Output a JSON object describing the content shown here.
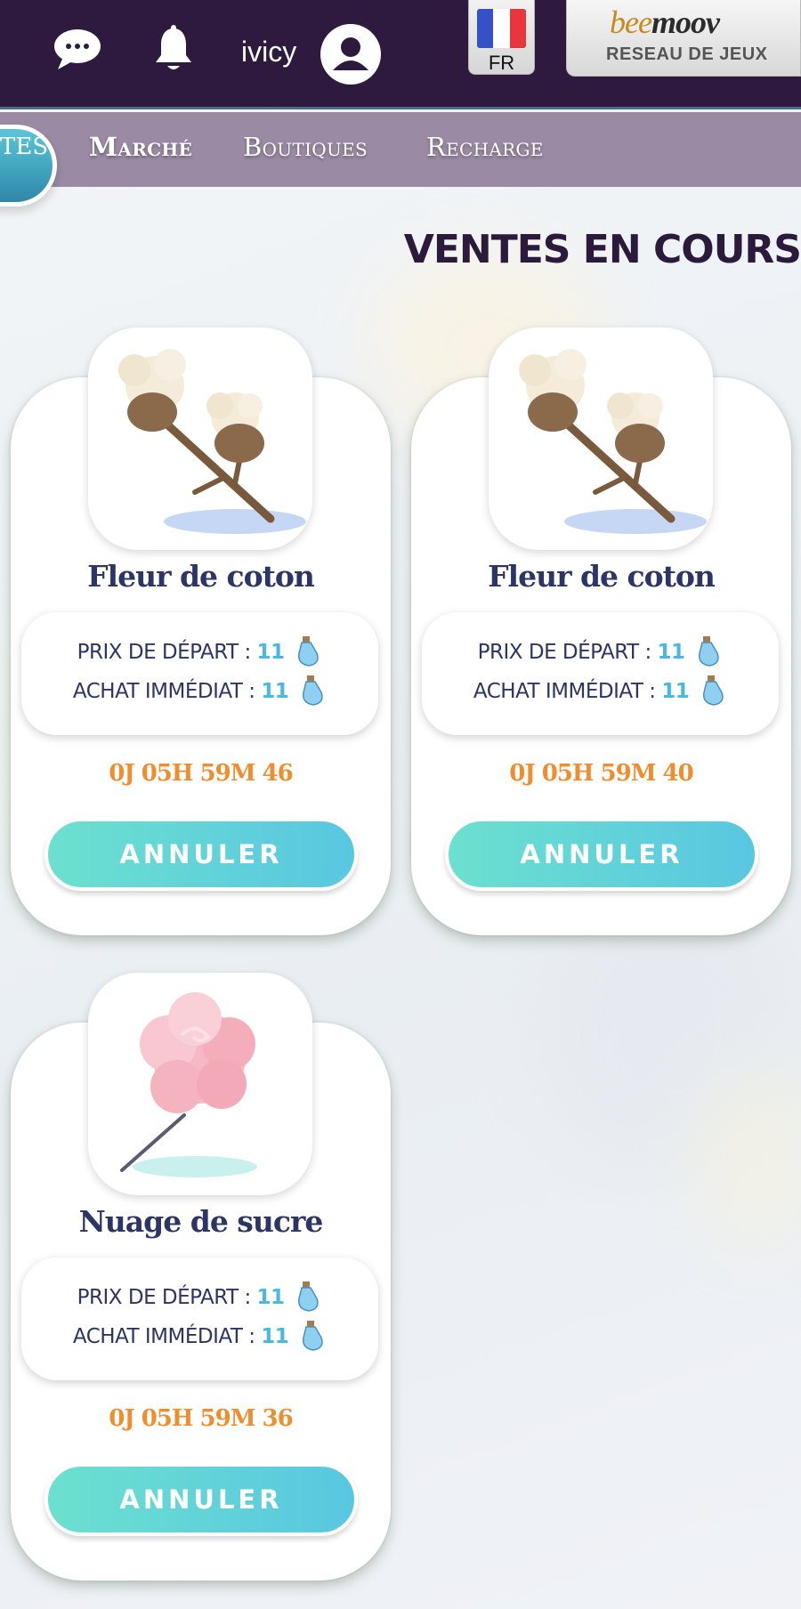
{
  "header": {
    "username": "ivicy",
    "language_code": "FR",
    "brand_logo": "beemoov",
    "brand_tagline": "RESEAU DE JEUX",
    "icons": [
      "chat-icon",
      "bell-icon",
      "avatar-icon",
      "flag-fr-icon"
    ]
  },
  "nav": {
    "active_partial": "TES",
    "items": [
      "Marché",
      "Boutiques",
      "Recharge"
    ]
  },
  "page_title": "VENTES EN COURS",
  "currency_icon": "potion-icon",
  "listings": [
    {
      "name": "Fleur de coton",
      "image": "cotton-flower",
      "start_label": "PRIX DE DÉPART :",
      "start_price": "11",
      "buyout_label": "ACHAT IMMÉDIAT :",
      "buyout_price": "11",
      "timer": "0J 05H 59M 46",
      "cancel_label": "ANNULER"
    },
    {
      "name": "Fleur de coton",
      "image": "cotton-flower",
      "start_label": "PRIX DE DÉPART :",
      "start_price": "11",
      "buyout_label": "ACHAT IMMÉDIAT :",
      "buyout_price": "11",
      "timer": "0J 05H 59M 40",
      "cancel_label": "ANNULER"
    },
    {
      "name": "Nuage de sucre",
      "image": "cotton-candy",
      "start_label": "PRIX DE DÉPART :",
      "start_price": "11",
      "buyout_label": "ACHAT IMMÉDIAT :",
      "buyout_price": "11",
      "timer": "0J 05H 59M 36",
      "cancel_label": "ANNULER"
    }
  ],
  "colors": {
    "topbar": "#2e1a3e",
    "nav": "#9a8aa3",
    "title": "#2b1a3b",
    "item_name": "#2c3566",
    "price_value": "#49b8e2",
    "timer": "#ef8d2f",
    "button_start": "#6ce0cf",
    "button_end": "#58c7e1"
  }
}
